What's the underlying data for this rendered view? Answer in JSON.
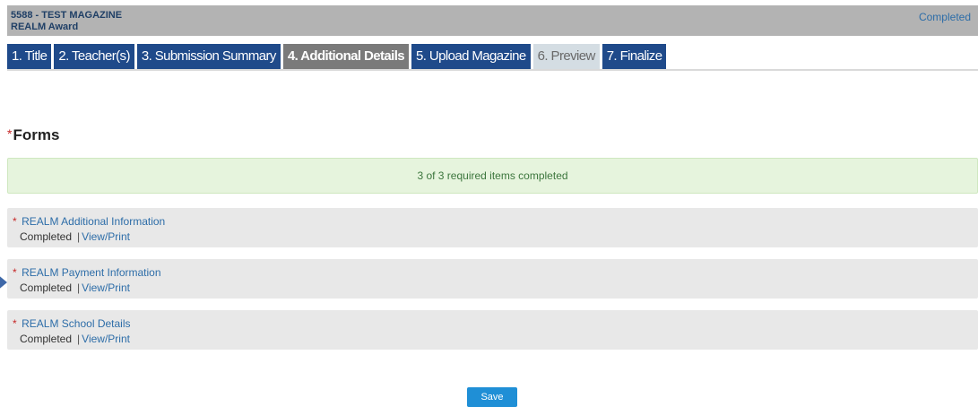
{
  "header": {
    "line1": "5588 - TEST MAGAZINE",
    "line2": "REALM Award",
    "status": "Completed"
  },
  "tabs": [
    {
      "label": "1. Title",
      "state": "normal"
    },
    {
      "label": "2. Teacher(s)",
      "state": "normal"
    },
    {
      "label": "3. Submission Summary",
      "state": "normal"
    },
    {
      "label": "4. Additional Details",
      "state": "active"
    },
    {
      "label": "5. Upload Magazine",
      "state": "normal"
    },
    {
      "label": "6. Preview",
      "state": "disabled"
    },
    {
      "label": "7. Finalize",
      "state": "normal"
    }
  ],
  "section": {
    "required_marker": "*",
    "title": "Forms"
  },
  "progress": {
    "text": "3 of 3 required items completed"
  },
  "forms": [
    {
      "required_marker": "*",
      "name": "REALM Additional Information",
      "status": "Completed",
      "separator": "|",
      "action": "View/Print"
    },
    {
      "required_marker": "*",
      "name": "REALM Payment Information",
      "status": "Completed",
      "separator": "|",
      "action": "View/Print"
    },
    {
      "required_marker": "*",
      "name": "REALM School Details",
      "status": "Completed",
      "separator": "|",
      "action": "View/Print"
    }
  ],
  "save_label": "Save",
  "colors": {
    "tab_active": "#7a7a7a",
    "tab_normal": "#1f4a8a",
    "tab_disabled": "#d4dde3",
    "link": "#2d6da8",
    "success_bg": "#e6f4dd",
    "success_text": "#3c763d",
    "save_button": "#1f8fd6",
    "required": "#c62828"
  },
  "icons": {
    "row_pointer": "pointer-arrow-icon"
  }
}
